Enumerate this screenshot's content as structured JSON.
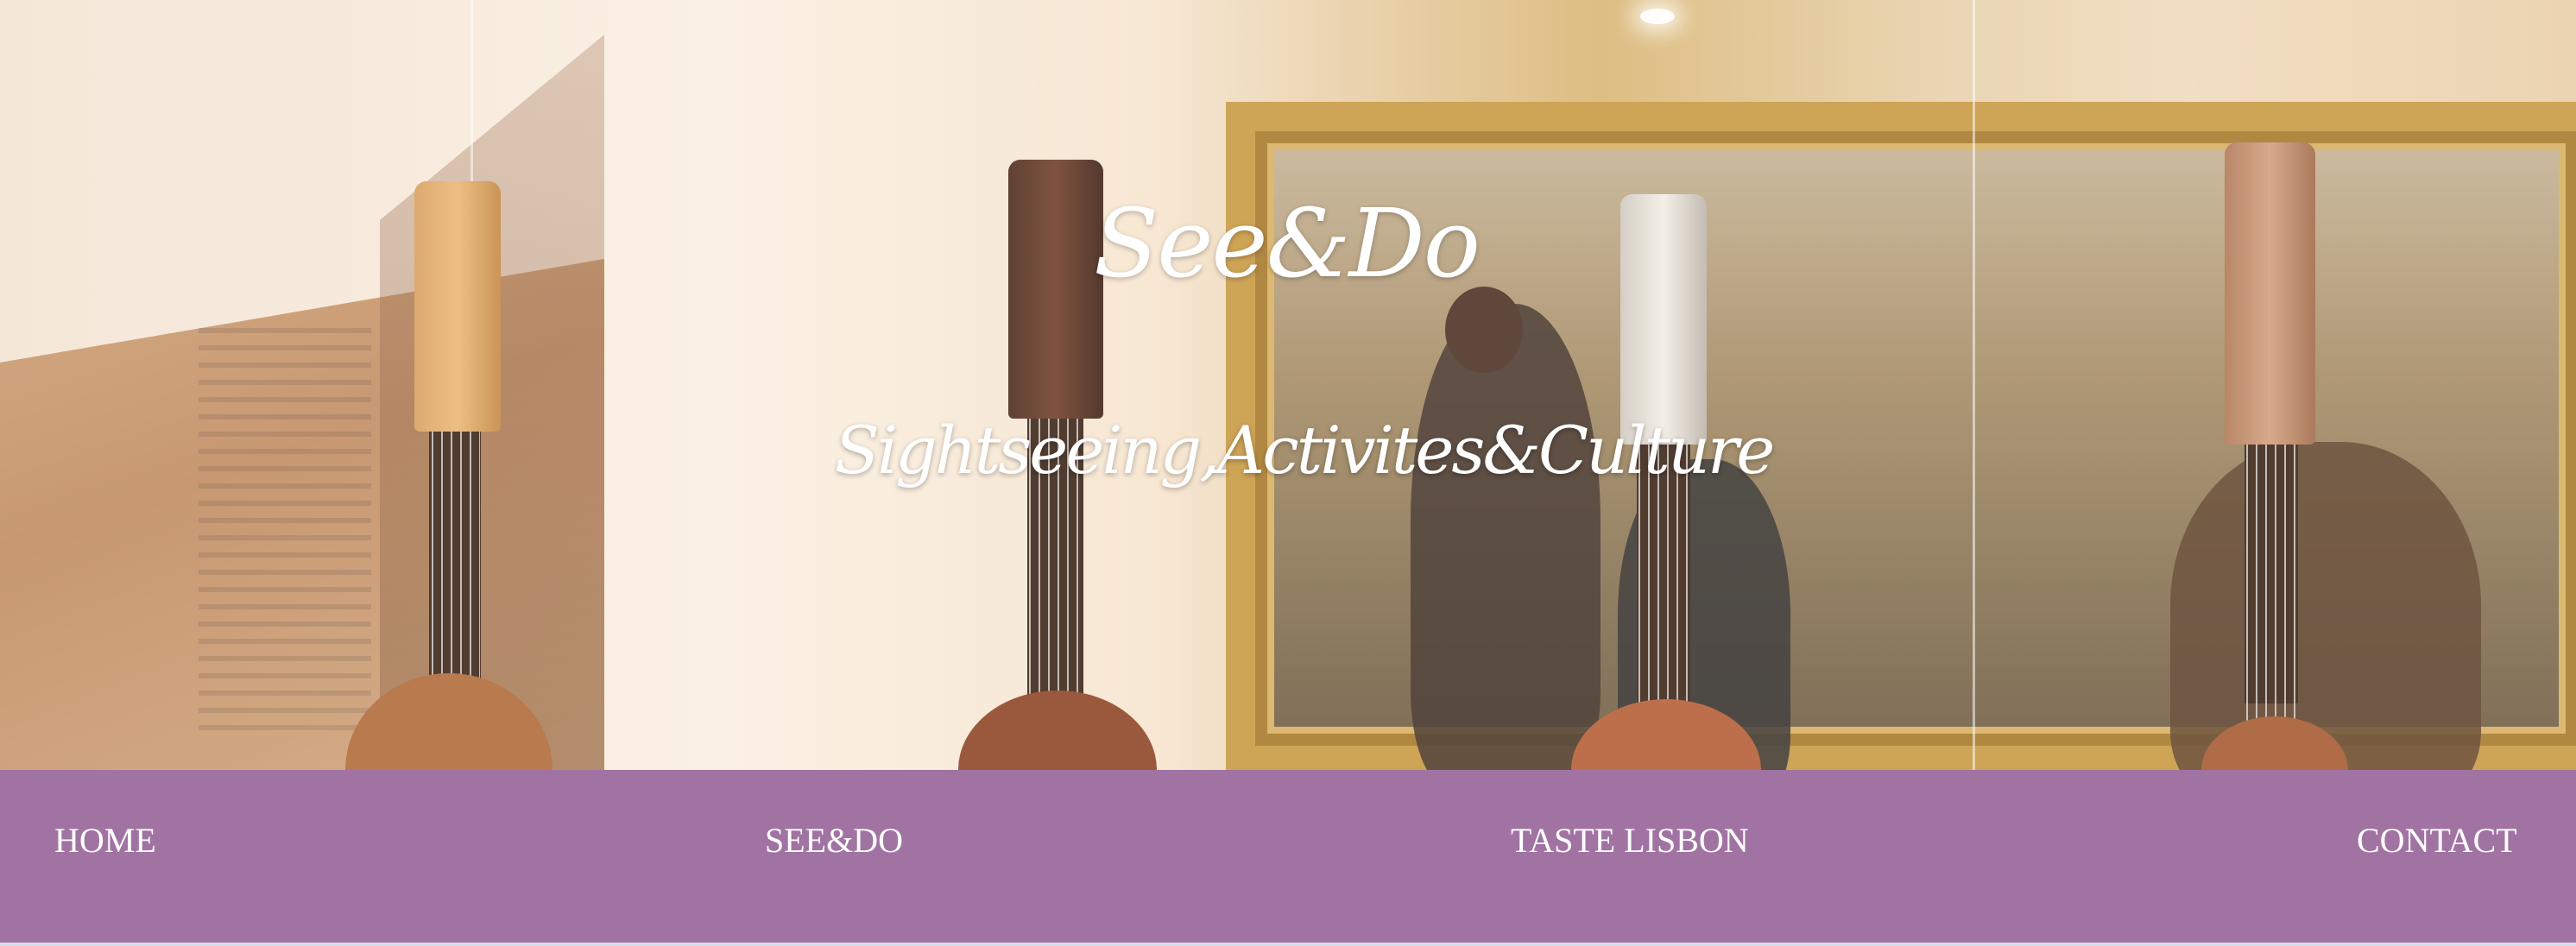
{
  "hero": {
    "title": "See&Do",
    "subtitle": "Sightseeing,Activites&Culture",
    "image": "mandolins-in-glass-case-museum-photo"
  },
  "nav": {
    "items": [
      {
        "label": "HOME"
      },
      {
        "label": "SEE&DO"
      },
      {
        "label": "TASTE LISBON"
      },
      {
        "label": "CONTACT"
      }
    ]
  },
  "colors": {
    "nav_background": "#a173a3",
    "nav_text": "#ffffff",
    "title_text": "#ffffff"
  }
}
